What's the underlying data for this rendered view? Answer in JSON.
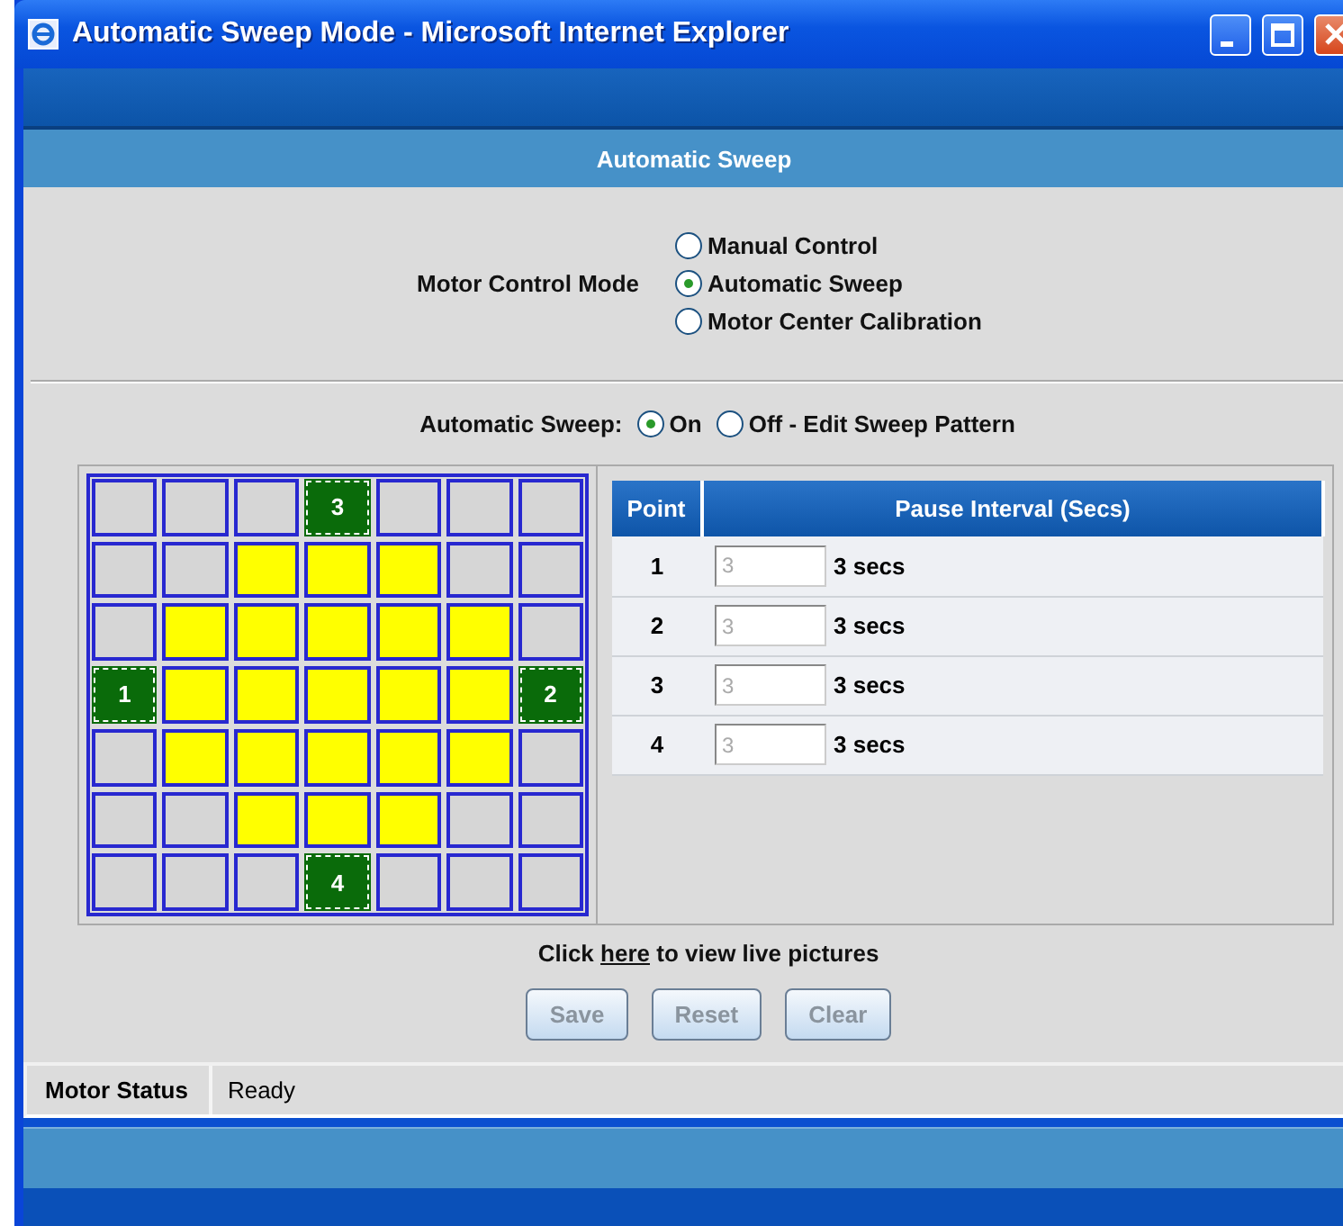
{
  "window": {
    "title": "Automatic Sweep Mode - Microsoft Internet Explorer"
  },
  "header": {
    "title": "Automatic Sweep"
  },
  "motor_control_mode": {
    "label": "Motor Control Mode",
    "options": [
      {
        "label": "Manual Control",
        "selected": false
      },
      {
        "label": "Automatic Sweep",
        "selected": true
      },
      {
        "label": "Motor Center Calibration",
        "selected": false
      }
    ]
  },
  "automatic_sweep": {
    "label": "Automatic Sweep:",
    "options": [
      {
        "label": "On",
        "selected": true
      },
      {
        "label": "Off - Edit Sweep Pattern",
        "selected": false
      }
    ]
  },
  "grid": {
    "rows": [
      [
        {
          "kind": "empty"
        },
        {
          "kind": "empty"
        },
        {
          "kind": "empty"
        },
        {
          "kind": "point",
          "label": "3"
        },
        {
          "kind": "empty"
        },
        {
          "kind": "empty"
        },
        {
          "kind": "empty"
        }
      ],
      [
        {
          "kind": "empty"
        },
        {
          "kind": "empty"
        },
        {
          "kind": "fill"
        },
        {
          "kind": "fill"
        },
        {
          "kind": "fill"
        },
        {
          "kind": "empty"
        },
        {
          "kind": "empty"
        }
      ],
      [
        {
          "kind": "empty"
        },
        {
          "kind": "fill"
        },
        {
          "kind": "fill"
        },
        {
          "kind": "fill"
        },
        {
          "kind": "fill"
        },
        {
          "kind": "fill"
        },
        {
          "kind": "empty"
        }
      ],
      [
        {
          "kind": "point",
          "label": "1"
        },
        {
          "kind": "fill"
        },
        {
          "kind": "fill"
        },
        {
          "kind": "fill"
        },
        {
          "kind": "fill"
        },
        {
          "kind": "fill"
        },
        {
          "kind": "point",
          "label": "2"
        }
      ],
      [
        {
          "kind": "empty"
        },
        {
          "kind": "fill"
        },
        {
          "kind": "fill"
        },
        {
          "kind": "fill"
        },
        {
          "kind": "fill"
        },
        {
          "kind": "fill"
        },
        {
          "kind": "empty"
        }
      ],
      [
        {
          "kind": "empty"
        },
        {
          "kind": "empty"
        },
        {
          "kind": "fill"
        },
        {
          "kind": "fill"
        },
        {
          "kind": "fill"
        },
        {
          "kind": "empty"
        },
        {
          "kind": "empty"
        }
      ],
      [
        {
          "kind": "empty"
        },
        {
          "kind": "empty"
        },
        {
          "kind": "empty"
        },
        {
          "kind": "point",
          "label": "4"
        },
        {
          "kind": "empty"
        },
        {
          "kind": "empty"
        },
        {
          "kind": "empty"
        }
      ]
    ]
  },
  "table": {
    "columns": [
      "Point",
      "Pause Interval (Secs)"
    ],
    "rows": [
      {
        "point": "1",
        "value": "3",
        "disabled": true,
        "reading": "3 secs"
      },
      {
        "point": "2",
        "value": "3",
        "disabled": true,
        "reading": "3 secs"
      },
      {
        "point": "3",
        "value": "3",
        "disabled": true,
        "reading": "3 secs"
      },
      {
        "point": "4",
        "value": "3",
        "disabled": true,
        "reading": "3 secs"
      }
    ]
  },
  "live_link": {
    "before": "Click",
    "link": "here",
    "after": "to view live pictures"
  },
  "buttons": [
    {
      "label": "Save",
      "disabled": true
    },
    {
      "label": "Reset",
      "disabled": true
    },
    {
      "label": "Clear",
      "disabled": true
    }
  ],
  "status_bar": {
    "label": "Motor Status",
    "value": "Ready"
  }
}
